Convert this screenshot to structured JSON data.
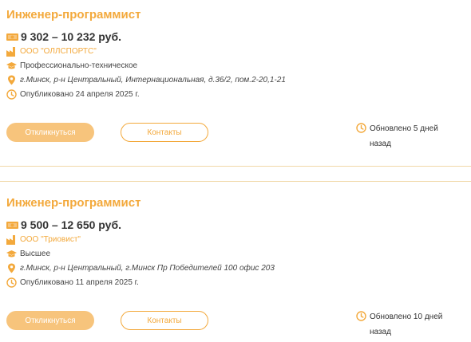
{
  "vacancies": [
    {
      "title": "Инженер-программист",
      "salary": "9 302 – 10 232 руб.",
      "company": "ООО \"ОЛЛСПОРТС\"",
      "education": "Профессионально-техническое",
      "address": "г.Минск, р-н Центральный, Интернациональная, д.36/2, пом.2-20,1-21",
      "published": "Опубликовано 24 апреля 2025 г.",
      "apply_label": "Откликнуться",
      "contacts_label": "Контакты",
      "updated": "Обновлено 5 дней назад"
    },
    {
      "title": "Инженер-программист",
      "salary": "9 500 – 12 650 руб.",
      "company": "ООО \"Триовист\"",
      "education": "Высшее",
      "address": "г.Минск, р-н Центральный, г.Минск Пр Победителей 100 офис 203",
      "published": "Опубликовано 11 апреля 2025 г.",
      "apply_label": "Откликнуться",
      "contacts_label": "Контакты",
      "updated": "Обновлено 10 дней назад"
    }
  ],
  "icons": {
    "salary": "money-icon",
    "company": "factory-icon",
    "education": "graduation-cap-icon",
    "address": "location-pin-icon",
    "published": "clock-icon",
    "updated": "clock-icon"
  },
  "colors": {
    "accent": "#f3a93c",
    "apply_button": "#f7c47c",
    "divider": "#f1d9a8"
  }
}
